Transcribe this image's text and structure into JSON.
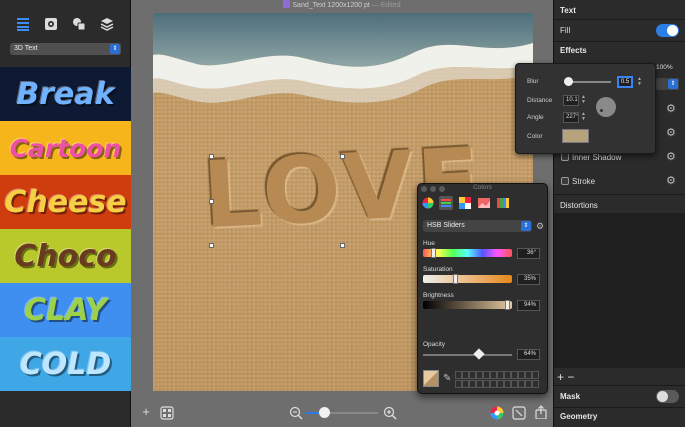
{
  "window": {
    "document_title": "Sand_Text 1200x1200 pt",
    "edited_label": "— Edited"
  },
  "sidebar": {
    "style_select": "3D Text",
    "toolbar_icons": [
      "text-list-icon",
      "gear-icon",
      "shapes-icon",
      "layers-icon"
    ],
    "presets": [
      {
        "label": "Break",
        "bg": "#0e1a33",
        "color": "#6fb2ff"
      },
      {
        "label": "Cartoon",
        "bg": "#f6b51b",
        "color": "#f04fa6"
      },
      {
        "label": "Cheese",
        "bg": "#cf3c0d",
        "color": "#f7cf45"
      },
      {
        "label": "Choco",
        "bg": "#b9c82a",
        "color": "#6a3a1f"
      },
      {
        "label": "CLAY",
        "bg": "#3f8ff0",
        "color": "#9cd14a"
      },
      {
        "label": "COLD",
        "bg": "#3fa7e6",
        "color": "#bfe6ff"
      }
    ]
  },
  "canvas": {
    "text": "LOVE"
  },
  "inspector": {
    "text_header": "Text",
    "fill_label": "Fill",
    "fill_on": true,
    "effects_header": "Effects",
    "percent_value": "100%",
    "inner_shadow_label": "Inner Shadow",
    "stroke_label": "Stroke",
    "distortions_header": "Distortions",
    "add_remove": "+ −",
    "mask_label": "Mask",
    "mask_on": false,
    "geometry_header": "Geometry"
  },
  "shadow_popover": {
    "blur_label": "Blur",
    "blur_value": "0.5",
    "distance_label": "Distance",
    "distance_value": "10.1",
    "angle_label": "Angle",
    "angle_value": "227°",
    "color_label": "Color",
    "color": "#b7a27e"
  },
  "colors_panel": {
    "title": "Colors",
    "mode_select": "HSB Sliders",
    "hue_label": "Hue",
    "hue_value": "36°",
    "saturation_label": "Saturation",
    "saturation_value": "35%",
    "brightness_label": "Brightness",
    "brightness_value": "94%",
    "opacity_label": "Opacity",
    "opacity_value": "64%"
  },
  "accent_color": "#2a7fe6"
}
